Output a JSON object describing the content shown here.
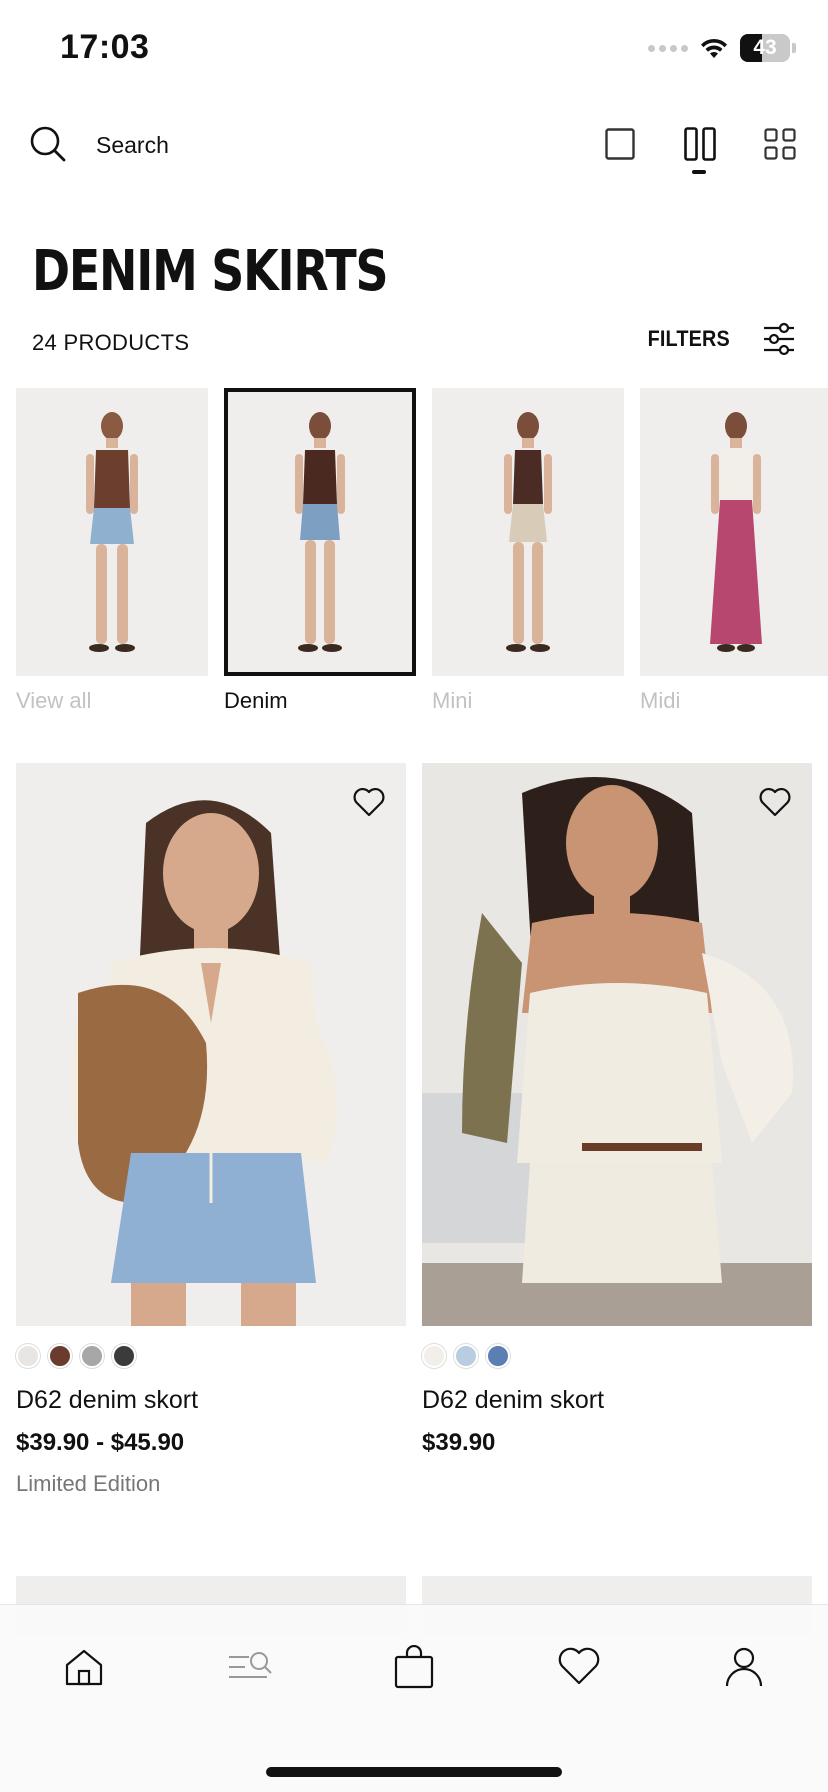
{
  "status_bar": {
    "time": "17:03",
    "battery": "43",
    "battery_level": 0.43,
    "icons": [
      "signal-icon",
      "wifi-icon",
      "battery-icon"
    ]
  },
  "search": {
    "label": "Search",
    "icon": "search-icon"
  },
  "view_toggles": {
    "options": [
      "single-column-view-icon",
      "two-column-view-icon",
      "grid-view-icon"
    ],
    "selected": "two-column-view-icon"
  },
  "page": {
    "title": "DENIM SKIRTS",
    "product_count": "24 PRODUCTS",
    "filters_label": "FILTERS",
    "filters_icon": "sliders-icon"
  },
  "categories": [
    {
      "label": "View all",
      "active": false
    },
    {
      "label": "Denim",
      "active": true
    },
    {
      "label": "Mini",
      "active": false
    },
    {
      "label": "Midi",
      "active": false
    }
  ],
  "products": [
    {
      "name": "D62 denim skort",
      "price": "$39.90 - $45.90",
      "note": "Limited Edition",
      "swatches": [
        "#e9e5e2",
        "#6b3b2e",
        "#a7a7a7",
        "#3b3b3b"
      ]
    },
    {
      "name": "D62 denim skort",
      "price": "$39.90",
      "note": "",
      "swatches": [
        "#f2efea",
        "#b9cde0",
        "#5c7fb3"
      ]
    }
  ],
  "bottom_nav": [
    "home-icon",
    "search-menu-icon",
    "bag-icon",
    "heart-icon",
    "account-icon"
  ]
}
